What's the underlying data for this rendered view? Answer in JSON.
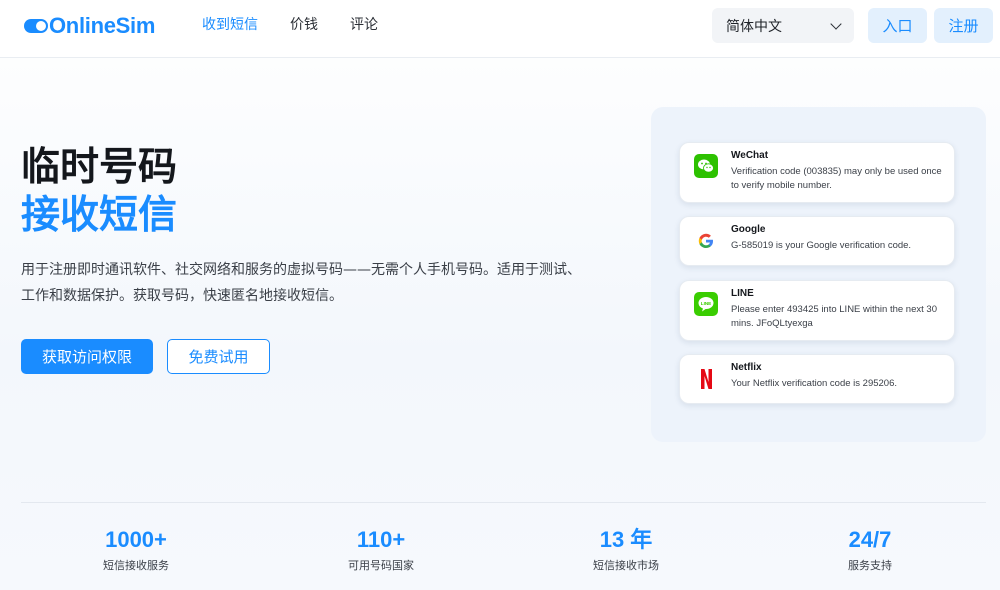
{
  "header": {
    "logo_text": "OnlineSim",
    "nav": [
      {
        "label": "收到短信",
        "active": true
      },
      {
        "label": "价钱",
        "active": false
      },
      {
        "label": "评论",
        "active": false
      }
    ],
    "language": "简体中文",
    "login_label": "入口",
    "register_label": "注册"
  },
  "hero": {
    "title_line1": "临时号码",
    "title_line2": "接收短信",
    "description": "用于注册即时通讯软件、社交网络和服务的虚拟号码——无需个人手机号码。适用于测试、工作和数据保护。获取号码，快速匿名地接收短信。",
    "primary_button": "获取访问权限",
    "secondary_button": "免费试用"
  },
  "messages": [
    {
      "service": "WeChat",
      "icon": "wechat-icon",
      "text": "Verification code (003835) may only be used once to verify mobile number."
    },
    {
      "service": "Google",
      "icon": "google-icon",
      "text": "G-585019 is your Google verification code."
    },
    {
      "service": "LINE",
      "icon": "line-icon",
      "text": "Please enter 493425 into LINE within the next 30 mins. JFoQLtyexga"
    },
    {
      "service": "Netflix",
      "icon": "netflix-icon",
      "text": "Your Netflix verification code is 295206."
    }
  ],
  "stats": [
    {
      "value": "1000+",
      "label": "短信接收服务"
    },
    {
      "value": "110+",
      "label": "可用号码国家"
    },
    {
      "value": "13 年",
      "label": "短信接收市场"
    },
    {
      "value": "24/7",
      "label": "服务支持"
    }
  ],
  "colors": {
    "accent": "#1a8cff",
    "wechat": "#2dc100",
    "line": "#3acd01",
    "netflix": "#e50914"
  }
}
